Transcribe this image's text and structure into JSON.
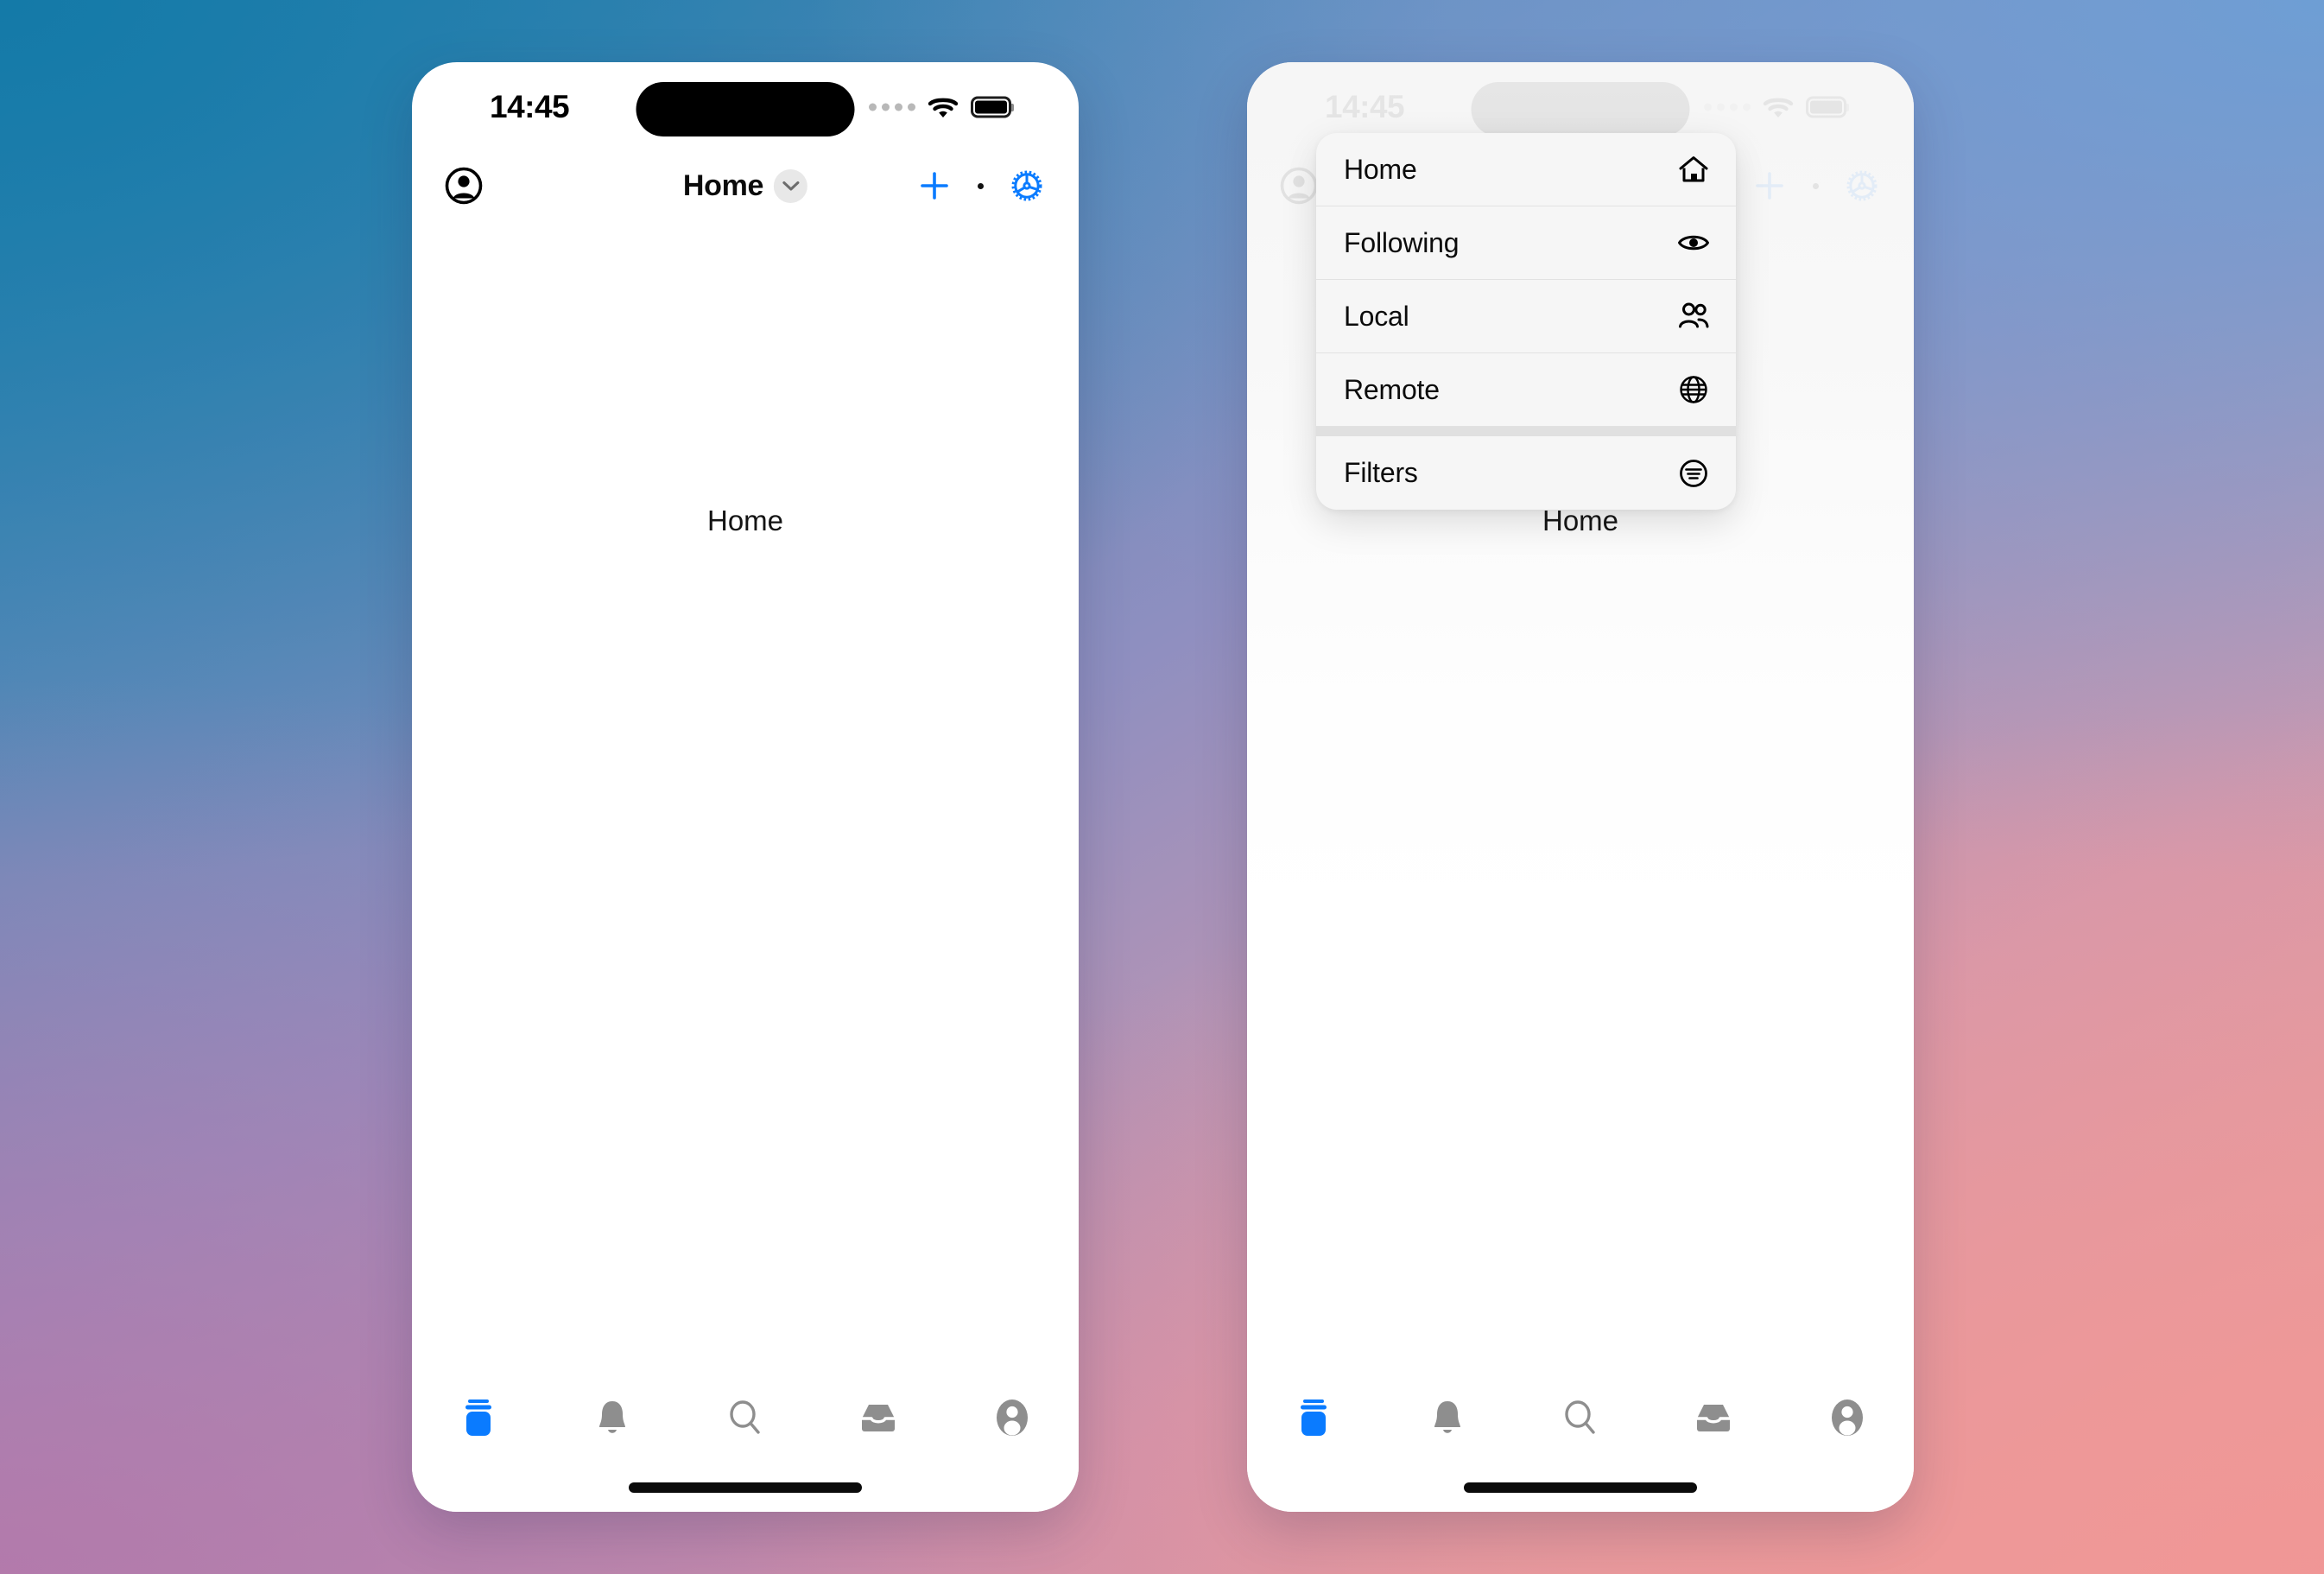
{
  "background": {
    "gradient_top_left": "#147aa8",
    "gradient_top_right": "#6e9ed4",
    "gradient_bottom_left": "#b078aa",
    "gradient_bottom_right": "#eb9b9b"
  },
  "accent_color": "#0a7bff",
  "status_bar": {
    "time": "14:45",
    "cellular_icon": "cellular-dots-icon",
    "wifi_icon": "wifi-icon",
    "battery_icon": "battery-full-icon",
    "dynamic_island": "dynamic-island"
  },
  "nav_bar": {
    "avatar_icon": "account-circle-icon",
    "title": "Home",
    "chevron_icon": "chevron-down-icon",
    "add_icon": "plus-icon",
    "dot_icon": "dot-icon",
    "settings_icon": "gear-icon"
  },
  "screens": [
    {
      "id": "left",
      "state": "menu-closed",
      "title_dimmed": false,
      "menu_open": false,
      "body_label": "Home"
    },
    {
      "id": "right",
      "state": "menu-open",
      "title_dimmed": true,
      "menu_open": true,
      "body_label": "Home"
    }
  ],
  "dropdown_menu": {
    "groups": [
      {
        "items": [
          {
            "label": "Home",
            "icon": "house-icon"
          },
          {
            "label": "Following",
            "icon": "eye-icon"
          },
          {
            "label": "Local",
            "icon": "people-icon"
          },
          {
            "label": "Remote",
            "icon": "globe-icon"
          }
        ]
      },
      {
        "items": [
          {
            "label": "Filters",
            "icon": "filter-circle-icon"
          }
        ]
      }
    ]
  },
  "tab_bar": {
    "items": [
      {
        "name": "feed",
        "icon": "stacked-layers-icon",
        "selected": true,
        "color": "#0a7bff"
      },
      {
        "name": "notifications",
        "icon": "bell-icon",
        "selected": false,
        "color": "#8e8e8e"
      },
      {
        "name": "search",
        "icon": "search-icon",
        "selected": false,
        "color": "#8e8e8e"
      },
      {
        "name": "inbox",
        "icon": "inbox-tray-icon",
        "selected": false,
        "color": "#8e8e8e"
      },
      {
        "name": "profile",
        "icon": "person-circle-icon",
        "selected": false,
        "color": "#8e8e8e"
      }
    ]
  },
  "home_indicator": "home-indicator-bar"
}
